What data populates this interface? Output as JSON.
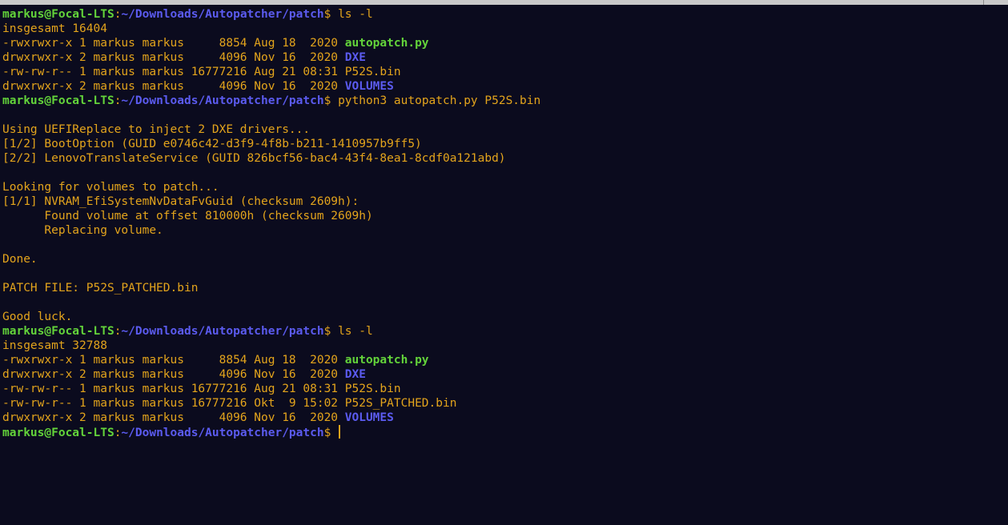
{
  "terminal": {
    "colors": {
      "background": "#0b0b1e",
      "text": "#e3a41c",
      "prompt_user": "#63d33a",
      "prompt_path": "#5b5bef",
      "executable": "#63d33a",
      "directory": "#5b5bef"
    },
    "lines": [
      {
        "type": "prompt",
        "user": "markus@Focal-LTS",
        "path": "~/Downloads/Autopatcher/patch",
        "symbol": "$ ",
        "command": "ls -l"
      },
      {
        "type": "text",
        "text": "insgesamt 16404"
      },
      {
        "type": "file",
        "meta": "-rwxrwxr-x 1 markus markus     8854 Aug 18  2020 ",
        "name": "autopatch.py",
        "kind": "exe"
      },
      {
        "type": "file",
        "meta": "drwxrwxr-x 2 markus markus     4096 Nov 16  2020 ",
        "name": "DXE",
        "kind": "dir"
      },
      {
        "type": "file",
        "meta": "-rw-rw-r-- 1 markus markus 16777216 Aug 21 08:31 ",
        "name": "P52S.bin",
        "kind": "plain"
      },
      {
        "type": "file",
        "meta": "drwxrwxr-x 2 markus markus     4096 Nov 16  2020 ",
        "name": "VOLUMES",
        "kind": "dir"
      },
      {
        "type": "prompt",
        "user": "markus@Focal-LTS",
        "path": "~/Downloads/Autopatcher/patch",
        "symbol": "$ ",
        "command": "python3 autopatch.py P52S.bin"
      },
      {
        "type": "text",
        "text": ""
      },
      {
        "type": "text",
        "text": "Using UEFIReplace to inject 2 DXE drivers..."
      },
      {
        "type": "text",
        "text": "[1/2] BootOption (GUID e0746c42-d3f9-4f8b-b211-1410957b9ff5)"
      },
      {
        "type": "text",
        "text": "[2/2] LenovoTranslateService (GUID 826bcf56-bac4-43f4-8ea1-8cdf0a121abd)"
      },
      {
        "type": "text",
        "text": ""
      },
      {
        "type": "text",
        "text": "Looking for volumes to patch..."
      },
      {
        "type": "text",
        "text": "[1/1] NVRAM_EfiSystemNvDataFvGuid (checksum 2609h):"
      },
      {
        "type": "text",
        "text": "      Found volume at offset 810000h (checksum 2609h)"
      },
      {
        "type": "text",
        "text": "      Replacing volume."
      },
      {
        "type": "text",
        "text": ""
      },
      {
        "type": "text",
        "text": "Done."
      },
      {
        "type": "text",
        "text": ""
      },
      {
        "type": "text",
        "text": "PATCH FILE: P52S_PATCHED.bin"
      },
      {
        "type": "text",
        "text": ""
      },
      {
        "type": "text",
        "text": "Good luck."
      },
      {
        "type": "prompt",
        "user": "markus@Focal-LTS",
        "path": "~/Downloads/Autopatcher/patch",
        "symbol": "$ ",
        "command": "ls -l"
      },
      {
        "type": "text",
        "text": "insgesamt 32788"
      },
      {
        "type": "file",
        "meta": "-rwxrwxr-x 1 markus markus     8854 Aug 18  2020 ",
        "name": "autopatch.py",
        "kind": "exe"
      },
      {
        "type": "file",
        "meta": "drwxrwxr-x 2 markus markus     4096 Nov 16  2020 ",
        "name": "DXE",
        "kind": "dir"
      },
      {
        "type": "file",
        "meta": "-rw-rw-r-- 1 markus markus 16777216 Aug 21 08:31 ",
        "name": "P52S.bin",
        "kind": "plain"
      },
      {
        "type": "file",
        "meta": "-rw-rw-r-- 1 markus markus 16777216 Okt  9 15:02 ",
        "name": "P52S_PATCHED.bin",
        "kind": "plain"
      },
      {
        "type": "file",
        "meta": "drwxrwxr-x 2 markus markus     4096 Nov 16  2020 ",
        "name": "VOLUMES",
        "kind": "dir"
      },
      {
        "type": "prompt",
        "user": "markus@Focal-LTS",
        "path": "~/Downloads/Autopatcher/patch",
        "symbol": "$ ",
        "command": "",
        "cursor": true
      }
    ]
  }
}
